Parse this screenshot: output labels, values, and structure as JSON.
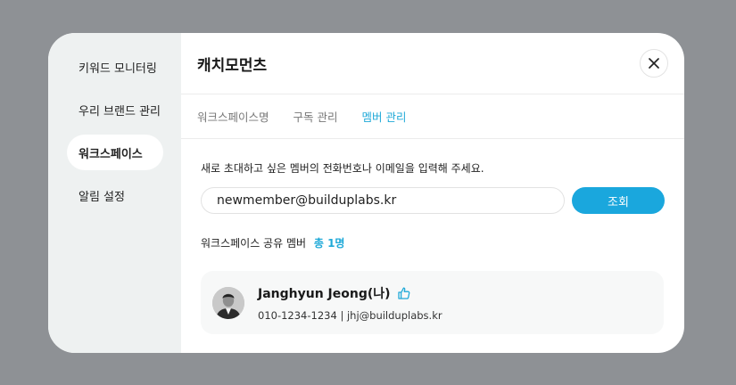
{
  "sidebar": {
    "items": [
      {
        "label": "키워드 모니터링"
      },
      {
        "label": "우리 브랜드 관리"
      },
      {
        "label": "워크스페이스"
      },
      {
        "label": "알림 설정"
      }
    ]
  },
  "header": {
    "title": "캐치모먼츠"
  },
  "tabs": [
    {
      "label": "워크스페이스명"
    },
    {
      "label": "구독 관리"
    },
    {
      "label": "멤버 관리"
    }
  ],
  "invite": {
    "instruction": "새로 초대하고 싶은 멤버의 전화번호나 이메일을 입력해 주세요.",
    "input_value": "newmember@builduplabs.kr",
    "search_label": "조회"
  },
  "members": {
    "heading": "워크스페이스 공유 멤버",
    "count": "총 1명",
    "list": [
      {
        "name": "Janghyun Jeong(나)",
        "contact": "010-1234-1234 | jhj@builduplabs.kr",
        "badge_icon": "thumbs-up-icon"
      }
    ]
  },
  "colors": {
    "accent": "#1fa9d8",
    "button": "#1aa7dd",
    "backdrop": "#8e9195",
    "sidebar_bg": "#eef1f1"
  }
}
